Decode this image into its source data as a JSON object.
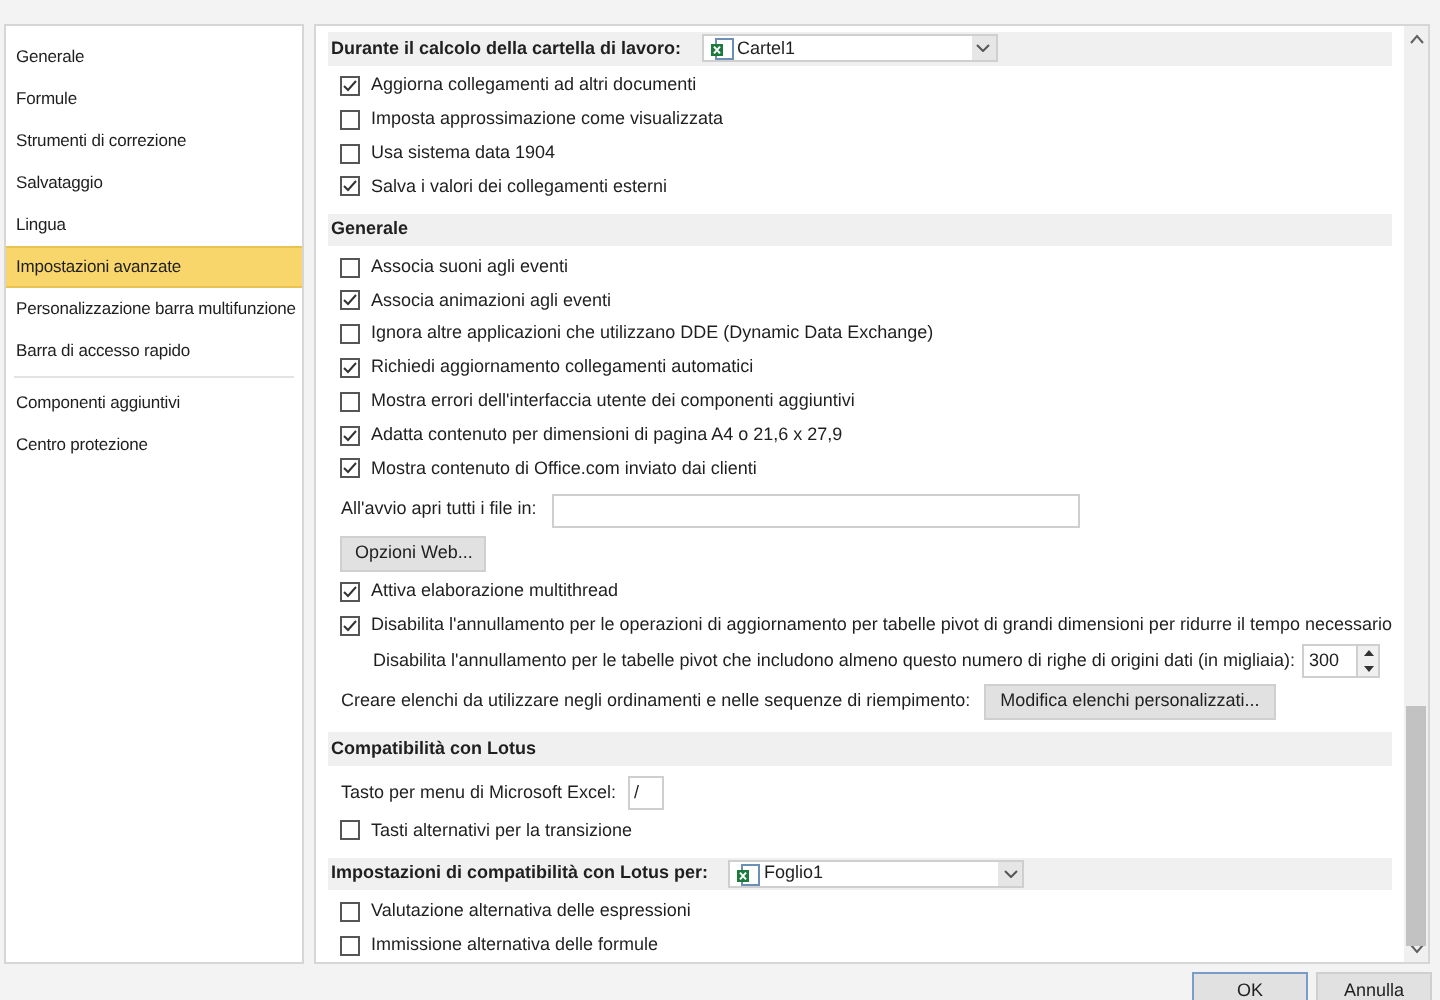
{
  "sidebar": {
    "groups": [
      [
        {
          "label": "Generale",
          "selected": false
        },
        {
          "label": "Formule",
          "selected": false
        },
        {
          "label": "Strumenti di correzione",
          "selected": false
        },
        {
          "label": "Salvataggio",
          "selected": false
        },
        {
          "label": "Lingua",
          "selected": false
        },
        {
          "label": "Impostazioni avanzate",
          "selected": true
        },
        {
          "label": "Personalizzazione barra multifunzione",
          "selected": false
        },
        {
          "label": "Barra di accesso rapido",
          "selected": false
        }
      ],
      [
        {
          "label": "Componenti aggiuntivi",
          "selected": false
        },
        {
          "label": "Centro protezione",
          "selected": false
        }
      ]
    ]
  },
  "content": [
    {
      "kind": "header",
      "label": "Durante il calcolo della cartella di lavoro:",
      "dropdown": "Cartel1"
    },
    {
      "kind": "checkbox",
      "label": "Aggiorna collegamenti ad altri documenti",
      "checked": true
    },
    {
      "kind": "checkbox",
      "label": "Imposta approssimazione come visualizzata",
      "checked": false
    },
    {
      "kind": "checkbox",
      "label": "Usa sistema data 1904",
      "checked": false
    },
    {
      "kind": "checkbox",
      "label": "Salva i valori dei collegamenti esterni",
      "checked": true
    },
    {
      "kind": "header",
      "label": "Generale"
    },
    {
      "kind": "checkbox",
      "label": "Associa suoni agli eventi",
      "checked": false
    },
    {
      "kind": "checkbox",
      "label": "Associa animazioni agli eventi",
      "checked": true
    },
    {
      "kind": "checkbox",
      "label": "Ignora altre applicazioni che utilizzano DDE (Dynamic Data Exchange)",
      "checked": false
    },
    {
      "kind": "checkbox",
      "label": "Richiedi aggiornamento collegamenti automatici",
      "checked": true
    },
    {
      "kind": "checkbox",
      "label": "Mostra errori dell'interfaccia utente dei componenti aggiuntivi",
      "checked": false
    },
    {
      "kind": "checkbox",
      "label": "Adatta contenuto per dimensioni di pagina A4 o 21,6 x 27,9",
      "checked": true
    },
    {
      "kind": "checkbox",
      "label": "Mostra contenuto di Office.com inviato dai clienti",
      "checked": true
    },
    {
      "kind": "textfield",
      "label": "All'avvio apri tutti i file in:"
    },
    {
      "kind": "button",
      "label": "Opzioni Web..."
    },
    {
      "kind": "checkbox",
      "label": "Attiva elaborazione multithread",
      "checked": true
    },
    {
      "kind": "checkbox",
      "label": "Disabilita l'annullamento per le operazioni di aggiornamento per tabelle pivot di grandi dimensioni per ridurre il tempo necessario",
      "checked": true
    },
    {
      "kind": "spinner",
      "label": "Disabilita l'annullamento per le tabelle pivot che includono almeno questo numero di righe di origini dati (in migliaia):",
      "value": "300"
    },
    {
      "kind": "labelbutton",
      "label": "Creare elenchi da utilizzare negli ordinamenti e nelle sequenze di riempimento:",
      "button": "Modifica elenchi personalizzati..."
    },
    {
      "kind": "header",
      "label": "Compatibilità con Lotus"
    },
    {
      "kind": "keyfield",
      "label": "Tasto per menu di Microsoft Excel:",
      "value": "/"
    },
    {
      "kind": "checkbox",
      "label": "Tasti alternativi per la transizione",
      "checked": false
    },
    {
      "kind": "header",
      "label": "Impostazioni di compatibilità con Lotus per:",
      "dropdown": "Foglio1"
    },
    {
      "kind": "checkbox",
      "label": "Valutazione alternativa delle espressioni",
      "checked": false
    },
    {
      "kind": "checkbox",
      "label": "Immissione alternativa delle formule",
      "checked": false
    }
  ],
  "buttons": [
    {
      "label": "OK"
    },
    {
      "label": "Annulla"
    }
  ]
}
